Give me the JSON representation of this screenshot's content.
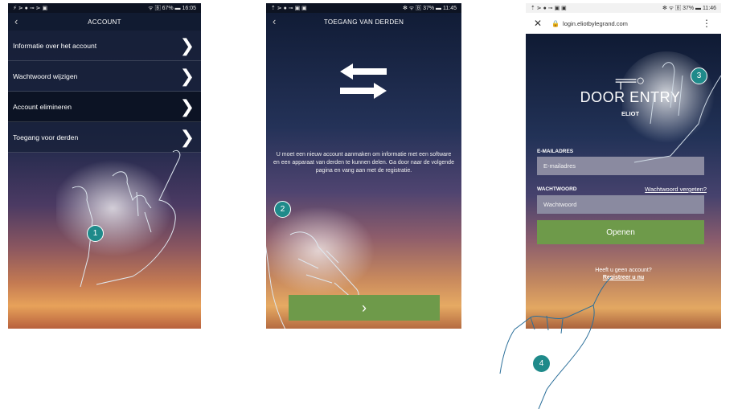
{
  "screen1": {
    "status": {
      "left": "⚡ ⋗ ● ⊸ ⋗ ▣",
      "right": "ᯤ 🄱 67% ▬ 16:05"
    },
    "title": "ACCOUNT",
    "items": [
      {
        "label": "Informatie over het account"
      },
      {
        "label": "Wachtwoord wijzigen"
      },
      {
        "label": "Account elimineren"
      },
      {
        "label": "Toegang voor derden"
      }
    ],
    "chevron": "❯",
    "step": "1"
  },
  "screen2": {
    "status": {
      "left": "⇡ ⋗ ● ⊸ ▣ ▣",
      "right": "✻ ᯤ 🄱 37% ▬ 11:45"
    },
    "title": "TOEGANG VAN DERDEN",
    "info": "U moet een nieuw account aanmaken om informatie met een software en een apparaat van derden te kunnen delen. Ga door naar de volgende pagina en vang aan met de registratie.",
    "next": "›",
    "step": "2"
  },
  "screen3": {
    "status": {
      "left": "⇡ ⋗ ● ⊸ ▣ ▣",
      "right": "✻ ᯤ 🄱 37% ▬ 11:46"
    },
    "url": "login.eliotbylegrand.com",
    "logo_brand": "DOOR ENTRY",
    "logo_sub": "ELIOT",
    "email_label": "E-MAILADRES",
    "email_placeholder": "E-mailadres",
    "password_label": "WACHTWOORD",
    "forgot": "Wachtwoord vergeten?",
    "password_placeholder": "Wachtwoord",
    "open": "Openen",
    "no_account": "Heeft u geen account?",
    "register": "Registreer u nu",
    "step3": "3",
    "step4": "4"
  },
  "colors": {
    "accent_green": "#6e9a4a",
    "badge_teal": "#1f8a8a"
  }
}
